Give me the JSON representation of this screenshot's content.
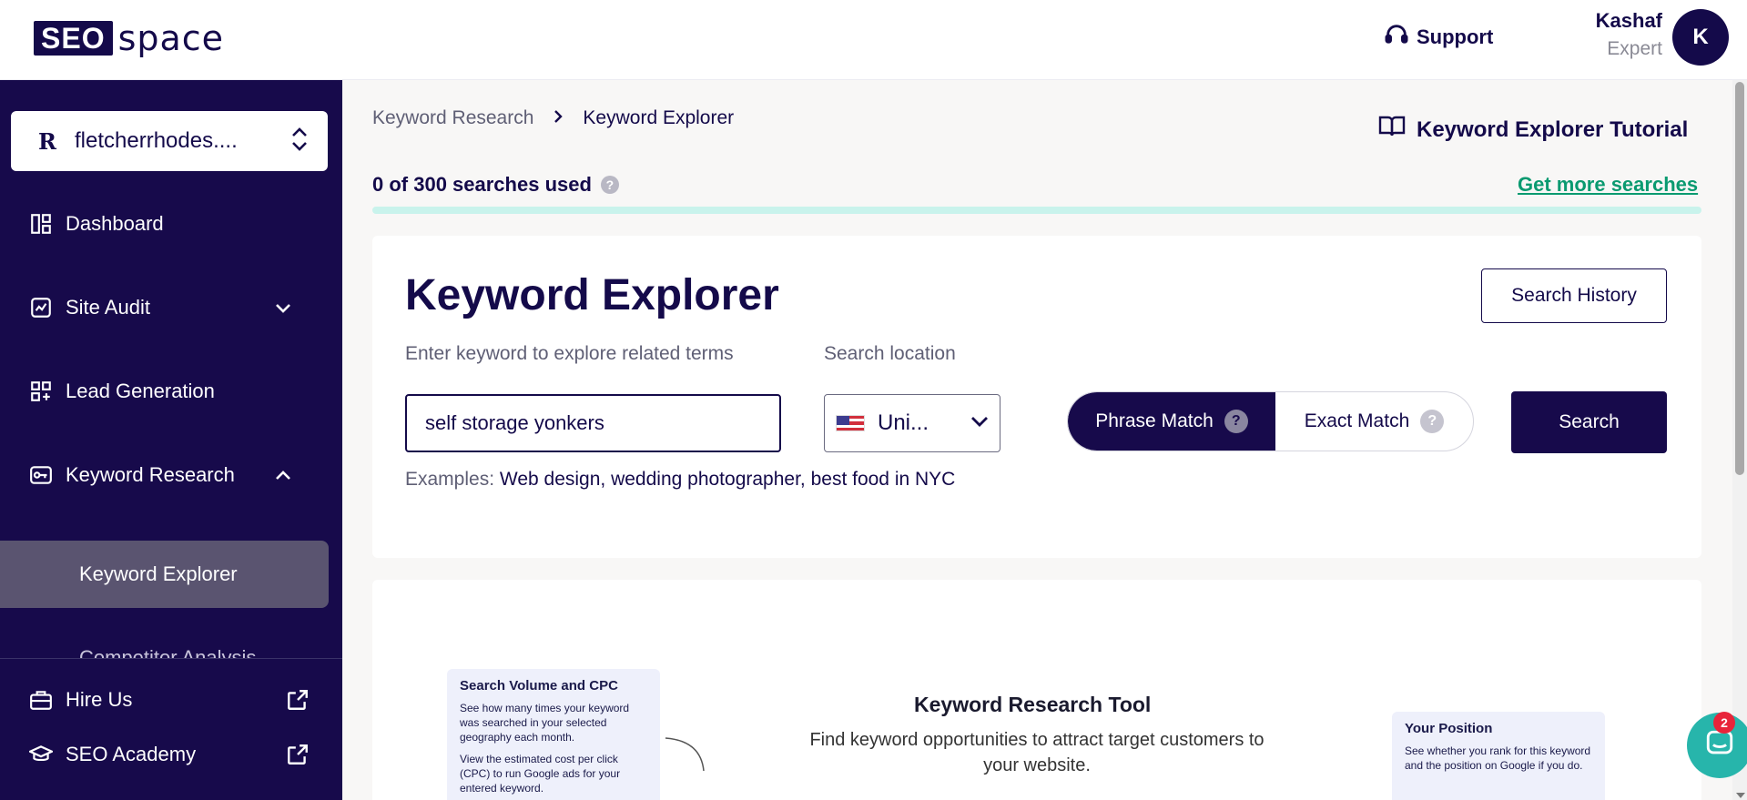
{
  "header": {
    "logo_box": "SEO",
    "logo_rest": "space",
    "support_label": "Support",
    "user_name": "Kashaf",
    "user_role": "Expert",
    "avatar_initial": "K"
  },
  "sidebar": {
    "site_logo": "R",
    "site_name": "fletcherrhodes....",
    "items": [
      {
        "label": "Dashboard",
        "icon": "dashboard-icon"
      },
      {
        "label": "Site Audit",
        "icon": "site-audit-icon"
      },
      {
        "label": "Lead Generation",
        "icon": "lead-generation-icon"
      },
      {
        "label": "Keyword Research",
        "icon": "key-icon"
      }
    ],
    "sub_active": "Keyword Explorer",
    "sub_cut": "Competitor Analysis",
    "bottom": [
      {
        "label": "Hire Us",
        "icon": "briefcase-icon"
      },
      {
        "label": "SEO Academy",
        "icon": "graduation-cap-icon"
      }
    ]
  },
  "breadcrumb": {
    "parent": "Keyword Research",
    "current": "Keyword Explorer"
  },
  "tutorial_label": "Keyword Explorer Tutorial",
  "usage": {
    "text": "0 of 300 searches used",
    "get_more": "Get more searches",
    "used": 0,
    "total": 300
  },
  "explorer": {
    "title": "Keyword Explorer",
    "history_label": "Search History",
    "keyword_label": "Enter keyword to explore related terms",
    "keyword_value": "self storage yonkers",
    "location_label": "Search location",
    "location_value": "Uni...",
    "phrase_match": "Phrase Match",
    "exact_match": "Exact Match",
    "search_label": "Search",
    "examples_label": "Examples:",
    "examples_text": "Web design, wedding photographer, best food in NYC"
  },
  "intro": {
    "tool_title": "Keyword Research Tool",
    "tool_sub": "Find keyword opportunities to attract target customers to your website.",
    "box1_title": "Search Volume and CPC",
    "box1_p1": "See how many times your keyword was searched in your selected geography each month.",
    "box1_p2": "View the estimated cost per click (CPC) to run Google ads for your entered keyword.",
    "box2_title": "Your Position",
    "box2_p1": "See whether you rank for this keyword and the position on Google if you do."
  },
  "chat": {
    "badge": "2"
  },
  "colors": {
    "brand": "#170a4b",
    "accent": "#0a9a70",
    "progress_track": "#c9f3ec"
  }
}
